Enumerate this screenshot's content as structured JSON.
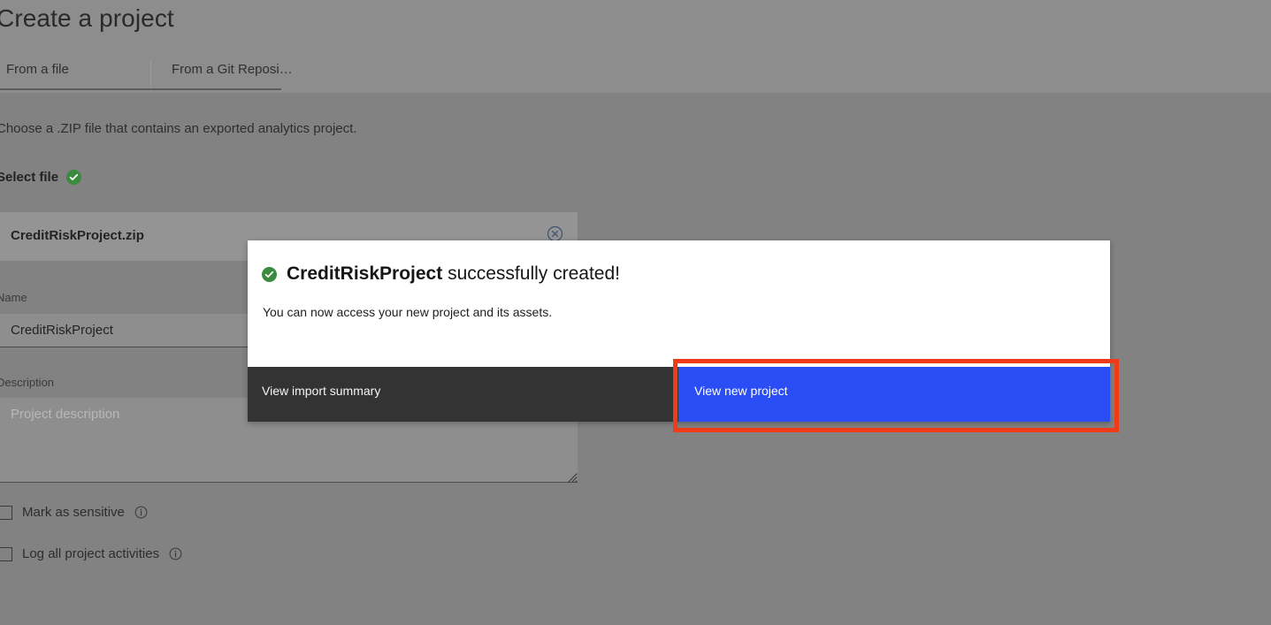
{
  "page": {
    "title": "Create a project",
    "intro": "Choose a .ZIP file that contains an exported analytics project.",
    "select_file_label": "Select file",
    "select_file_status_icon": "check-circle-icon"
  },
  "tabs": [
    {
      "label": "From a file",
      "selected": true
    },
    {
      "label": "From a Git Reposi…",
      "selected": false
    }
  ],
  "file": {
    "name": "CreditRiskProject.zip",
    "remove_icon": "close-circle-icon"
  },
  "form": {
    "name_label": "Name",
    "name_value": "CreditRiskProject",
    "description_label": "Description",
    "description_value": "",
    "description_placeholder": "Project description",
    "checkboxes": [
      {
        "label": "Mark as sensitive",
        "checked": false,
        "info_icon": "info-icon"
      },
      {
        "label": "Log all project activities",
        "checked": false,
        "info_icon": "info-icon"
      }
    ]
  },
  "modal": {
    "status_icon": "success-check-icon",
    "title_strong": "CreditRiskProject",
    "title_rest": " successfully created!",
    "subtitle": "You can now access your new project and its assets.",
    "secondary_button": "View import summary",
    "primary_button": "View new project"
  },
  "colors": {
    "accent_blue": "#2a4df5",
    "success_green": "#3a8a3f",
    "highlight_red": "#ef3b18",
    "footer_dark": "#333333",
    "overlay_grey": "#828282"
  }
}
